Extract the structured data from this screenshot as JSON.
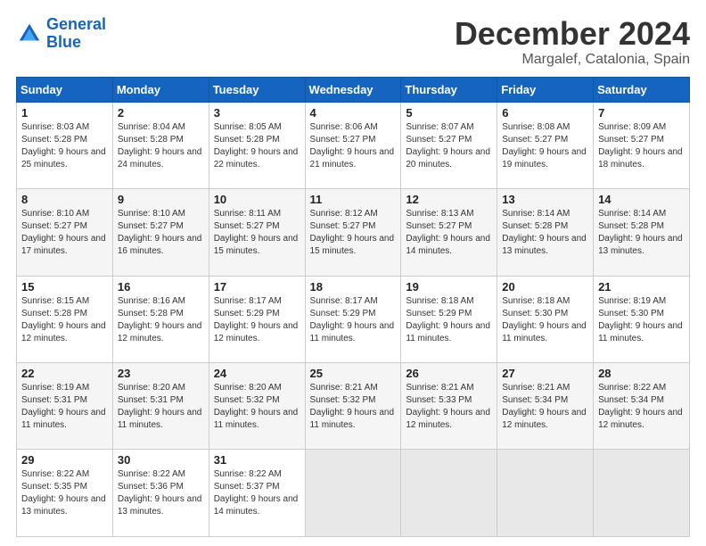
{
  "logo": {
    "line1": "General",
    "line2": "Blue"
  },
  "title": "December 2024",
  "location": "Margalef, Catalonia, Spain",
  "days_of_week": [
    "Sunday",
    "Monday",
    "Tuesday",
    "Wednesday",
    "Thursday",
    "Friday",
    "Saturday"
  ],
  "weeks": [
    [
      {
        "day": "1",
        "sunrise": "8:03 AM",
        "sunset": "5:28 PM",
        "daylight": "9 hours and 25 minutes."
      },
      {
        "day": "2",
        "sunrise": "8:04 AM",
        "sunset": "5:28 PM",
        "daylight": "9 hours and 24 minutes."
      },
      {
        "day": "3",
        "sunrise": "8:05 AM",
        "sunset": "5:28 PM",
        "daylight": "9 hours and 22 minutes."
      },
      {
        "day": "4",
        "sunrise": "8:06 AM",
        "sunset": "5:27 PM",
        "daylight": "9 hours and 21 minutes."
      },
      {
        "day": "5",
        "sunrise": "8:07 AM",
        "sunset": "5:27 PM",
        "daylight": "9 hours and 20 minutes."
      },
      {
        "day": "6",
        "sunrise": "8:08 AM",
        "sunset": "5:27 PM",
        "daylight": "9 hours and 19 minutes."
      },
      {
        "day": "7",
        "sunrise": "8:09 AM",
        "sunset": "5:27 PM",
        "daylight": "9 hours and 18 minutes."
      }
    ],
    [
      {
        "day": "8",
        "sunrise": "8:10 AM",
        "sunset": "5:27 PM",
        "daylight": "9 hours and 17 minutes."
      },
      {
        "day": "9",
        "sunrise": "8:10 AM",
        "sunset": "5:27 PM",
        "daylight": "9 hours and 16 minutes."
      },
      {
        "day": "10",
        "sunrise": "8:11 AM",
        "sunset": "5:27 PM",
        "daylight": "9 hours and 15 minutes."
      },
      {
        "day": "11",
        "sunrise": "8:12 AM",
        "sunset": "5:27 PM",
        "daylight": "9 hours and 15 minutes."
      },
      {
        "day": "12",
        "sunrise": "8:13 AM",
        "sunset": "5:27 PM",
        "daylight": "9 hours and 14 minutes."
      },
      {
        "day": "13",
        "sunrise": "8:14 AM",
        "sunset": "5:28 PM",
        "daylight": "9 hours and 13 minutes."
      },
      {
        "day": "14",
        "sunrise": "8:14 AM",
        "sunset": "5:28 PM",
        "daylight": "9 hours and 13 minutes."
      }
    ],
    [
      {
        "day": "15",
        "sunrise": "8:15 AM",
        "sunset": "5:28 PM",
        "daylight": "9 hours and 12 minutes."
      },
      {
        "day": "16",
        "sunrise": "8:16 AM",
        "sunset": "5:28 PM",
        "daylight": "9 hours and 12 minutes."
      },
      {
        "day": "17",
        "sunrise": "8:17 AM",
        "sunset": "5:29 PM",
        "daylight": "9 hours and 12 minutes."
      },
      {
        "day": "18",
        "sunrise": "8:17 AM",
        "sunset": "5:29 PM",
        "daylight": "9 hours and 11 minutes."
      },
      {
        "day": "19",
        "sunrise": "8:18 AM",
        "sunset": "5:29 PM",
        "daylight": "9 hours and 11 minutes."
      },
      {
        "day": "20",
        "sunrise": "8:18 AM",
        "sunset": "5:30 PM",
        "daylight": "9 hours and 11 minutes."
      },
      {
        "day": "21",
        "sunrise": "8:19 AM",
        "sunset": "5:30 PM",
        "daylight": "9 hours and 11 minutes."
      }
    ],
    [
      {
        "day": "22",
        "sunrise": "8:19 AM",
        "sunset": "5:31 PM",
        "daylight": "9 hours and 11 minutes."
      },
      {
        "day": "23",
        "sunrise": "8:20 AM",
        "sunset": "5:31 PM",
        "daylight": "9 hours and 11 minutes."
      },
      {
        "day": "24",
        "sunrise": "8:20 AM",
        "sunset": "5:32 PM",
        "daylight": "9 hours and 11 minutes."
      },
      {
        "day": "25",
        "sunrise": "8:21 AM",
        "sunset": "5:32 PM",
        "daylight": "9 hours and 11 minutes."
      },
      {
        "day": "26",
        "sunrise": "8:21 AM",
        "sunset": "5:33 PM",
        "daylight": "9 hours and 12 minutes."
      },
      {
        "day": "27",
        "sunrise": "8:21 AM",
        "sunset": "5:34 PM",
        "daylight": "9 hours and 12 minutes."
      },
      {
        "day": "28",
        "sunrise": "8:22 AM",
        "sunset": "5:34 PM",
        "daylight": "9 hours and 12 minutes."
      }
    ],
    [
      {
        "day": "29",
        "sunrise": "8:22 AM",
        "sunset": "5:35 PM",
        "daylight": "9 hours and 13 minutes."
      },
      {
        "day": "30",
        "sunrise": "8:22 AM",
        "sunset": "5:36 PM",
        "daylight": "9 hours and 13 minutes."
      },
      {
        "day": "31",
        "sunrise": "8:22 AM",
        "sunset": "5:37 PM",
        "daylight": "9 hours and 14 minutes."
      },
      null,
      null,
      null,
      null
    ]
  ]
}
